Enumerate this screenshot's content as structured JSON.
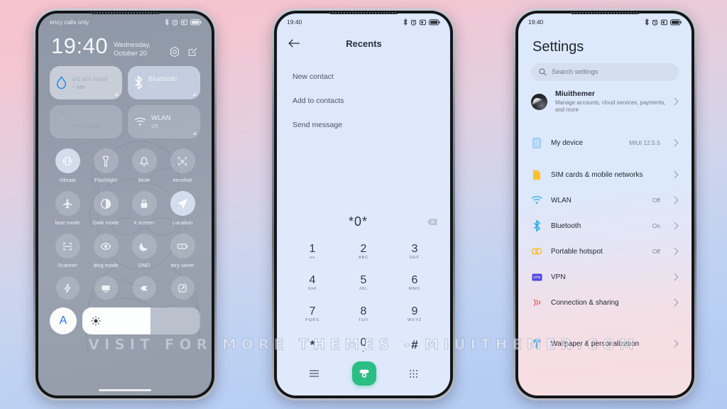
{
  "watermark": {
    "text": "VISIT FOR MORE THEMES - MIUITHEMER.COM"
  },
  "phone1": {
    "name": "control-center",
    "statusbar": {
      "carrier": "ency calls only",
      "icons": [
        "bluetooth-icon",
        "alarm-icon",
        "dnd-icon",
        "battery-icon"
      ]
    },
    "clock": {
      "time": "19:40",
      "date": "Wednesday, October 20",
      "settings_icon": "settings-gear-icon",
      "edit_icon": "edit-icon"
    },
    "big_tiles": [
      {
        "icon": "water-drop-icon",
        "title": "ard isn't install",
        "sub": "-- MB",
        "state": "off"
      },
      {
        "icon": "bluetooth-icon",
        "title": "Bluetooth",
        "sub": "On",
        "state": "on"
      },
      {
        "icon": "mobile-data-icon",
        "title": "ile data",
        "sub": "Not available",
        "state": "off"
      },
      {
        "icon": "wlan-icon",
        "title": "WLAN",
        "sub": "Off",
        "state": "off"
      }
    ],
    "toggles": [
      {
        "icon": "vibrate-icon",
        "label": "Vibrate",
        "state": "on"
      },
      {
        "icon": "flashlight-icon",
        "label": "Flashlight",
        "state": "off"
      },
      {
        "icon": "bell-icon",
        "label": "Mute",
        "state": "off"
      },
      {
        "icon": "screenshot-icon",
        "label": "eenshot",
        "state": "off"
      },
      {
        "icon": "airplane-icon",
        "label": "lane mode",
        "state": "off"
      },
      {
        "icon": "dark-mode-icon",
        "label": "Dark mode",
        "state": "off"
      },
      {
        "icon": "lock-icon",
        "label": "k screen",
        "state": "off"
      },
      {
        "icon": "location-icon",
        "label": "Location",
        "state": "on"
      },
      {
        "icon": "scanner-icon",
        "label": "Scanner",
        "state": "off"
      },
      {
        "icon": "reading-mode-icon",
        "label": "ding mode",
        "state": "off"
      },
      {
        "icon": "moon-icon",
        "label": "DND",
        "state": "off"
      },
      {
        "icon": "battery-saver-icon",
        "label": "tery saver",
        "state": "off"
      }
    ],
    "toggles_row4": [
      {
        "icon": "lightning-icon",
        "label": "",
        "state": "off"
      },
      {
        "icon": "cast-icon",
        "label": "",
        "state": "off"
      },
      {
        "icon": "card-icon",
        "label": "",
        "state": "off"
      },
      {
        "icon": "screen-cast-icon",
        "label": "",
        "state": "off"
      }
    ],
    "brightness": {
      "auto_label": "A",
      "icon": "brightness-icon",
      "level": 58
    }
  },
  "phone2": {
    "name": "dialer",
    "statusbar": {
      "time": "19:40",
      "icons": [
        "bluetooth-icon",
        "alarm-icon",
        "dnd-icon",
        "battery-icon"
      ]
    },
    "header": {
      "back_icon": "back-arrow-icon",
      "title": "Recents"
    },
    "menu": [
      "New contact",
      "Add to contacts",
      "Send message"
    ],
    "display": {
      "number": "*0*",
      "backspace_icon": "backspace-icon"
    },
    "keys": [
      {
        "digit": "1",
        "letters": "oo"
      },
      {
        "digit": "2",
        "letters": "ABC"
      },
      {
        "digit": "3",
        "letters": "DEF"
      },
      {
        "digit": "4",
        "letters": "GHI"
      },
      {
        "digit": "5",
        "letters": "JKL"
      },
      {
        "digit": "6",
        "letters": "MNO"
      },
      {
        "digit": "7",
        "letters": "PQRS"
      },
      {
        "digit": "8",
        "letters": "TUV"
      },
      {
        "digit": "9",
        "letters": "WXYZ"
      },
      {
        "digit": "*",
        "letters": ""
      },
      {
        "digit": "0",
        "letters": "+"
      },
      {
        "digit": "#",
        "letters": ""
      }
    ],
    "bottom": {
      "menu_icon": "list-menu-icon",
      "call_icon": "phone-call-icon",
      "keypad_icon": "keypad-icon",
      "call_color": "#2bbd84"
    }
  },
  "phone3": {
    "name": "settings",
    "statusbar": {
      "time": "19:40",
      "icons": [
        "bluetooth-icon",
        "alarm-icon",
        "dnd-icon",
        "battery-icon"
      ]
    },
    "title": "Settings",
    "search": {
      "icon": "search-icon",
      "placeholder": "Search settings"
    },
    "account": {
      "avatar": "user-avatar",
      "name": "Miuithemer",
      "sub": "Manage accounts, cloud services, payments, and more",
      "chevron": "chevron-right-icon"
    },
    "items": [
      {
        "icon": "device-icon",
        "label": "My device",
        "value": "MIUI 12.5.5"
      },
      {
        "icon": "sim-card-icon",
        "label": "SIM cards & mobile networks",
        "value": ""
      },
      {
        "icon": "wlan-icon",
        "label": "WLAN",
        "value": "Off"
      },
      {
        "icon": "bluetooth-icon",
        "label": "Bluetooth",
        "value": "On"
      },
      {
        "icon": "hotspot-icon",
        "label": "Portable hotspot",
        "value": "Off"
      },
      {
        "icon": "vpn-icon",
        "label": "VPN",
        "value": ""
      },
      {
        "icon": "connection-icon",
        "label": "Connection & sharing",
        "value": ""
      },
      {
        "icon": "wallpaper-icon",
        "label": "Wallpaper & personalization",
        "value": ""
      }
    ]
  }
}
